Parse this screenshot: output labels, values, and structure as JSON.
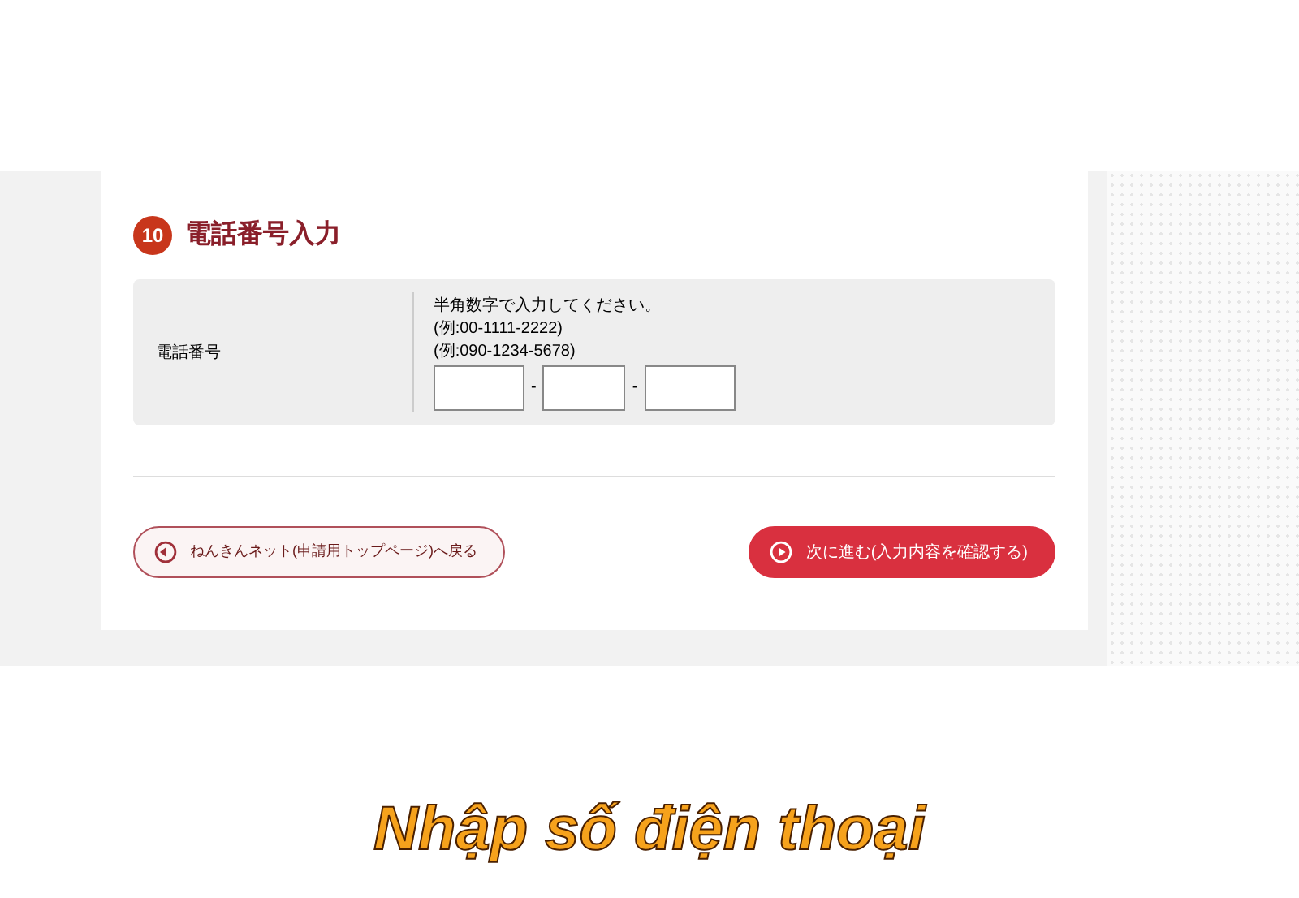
{
  "section": {
    "number": "10",
    "title": "電話番号入力"
  },
  "form": {
    "label": "電話番号",
    "instruction": "半角数字で入力してください。",
    "examples": [
      "(例:00-1111-2222)",
      "(例:090-1234-5678)"
    ],
    "fields": [
      {
        "kind": "text"
      },
      {
        "kind": "text"
      },
      {
        "kind": "text"
      }
    ],
    "separator": "-"
  },
  "buttons": [
    {
      "kind": "back",
      "label": "ねんきんネット(申請用トップページ)へ戻る"
    },
    {
      "kind": "next",
      "label": "次に進む(入力内容を確認する)"
    }
  ],
  "caption": "Nhập số điện thoại"
}
